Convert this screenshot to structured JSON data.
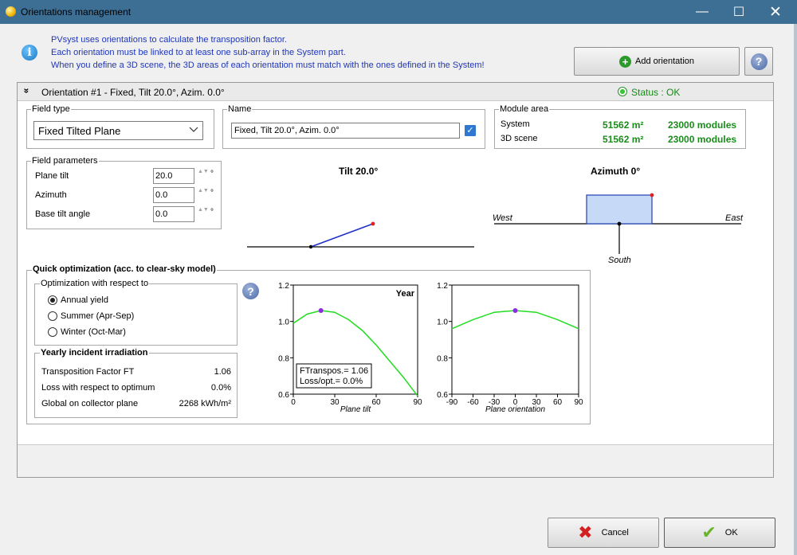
{
  "window": {
    "title": "Orientations management",
    "min_glyph": "—",
    "max_glyph": "☐",
    "close_glyph": "✕"
  },
  "info": {
    "line1": "PVsyst uses orientations to calculate the transposition factor.",
    "line2": "Each orientation must be linked to at least one sub-array in the System part.",
    "line3": "When you define a 3D scene, the 3D areas of each orientation must match with the ones defined in the System!",
    "icon": "info-icon"
  },
  "toolbar": {
    "add_orientation_label": "Add orientation",
    "help_glyph": "?"
  },
  "orientation": {
    "collapse_glyph": "»",
    "title": "Orientation #1 - Fixed, Tilt 20.0°, Azim. 0.0°",
    "status": "Status : OK",
    "status_color": "#168a16"
  },
  "field_type": {
    "label": "Field type",
    "selected": "Fixed Tilted Plane"
  },
  "name": {
    "label": "Name",
    "value": "Fixed, Tilt 20.0°, Azim. 0.0°",
    "checked": true,
    "check_glyph": "✓"
  },
  "module_area": {
    "label": "Module area",
    "rows": [
      {
        "label": "System",
        "area": "51562 m²",
        "modules": "23000 modules"
      },
      {
        "label": "3D scene",
        "area": "51562 m²",
        "modules": "23000 modules"
      }
    ]
  },
  "field_parameters": {
    "label": "Field parameters",
    "unit": "°",
    "spin_glyph": "▲▼",
    "items": [
      {
        "label": "Plane tilt",
        "value": "20.0"
      },
      {
        "label": "Azimuth",
        "value": "0.0"
      },
      {
        "label": "Base tilt angle",
        "value": "0.0"
      }
    ]
  },
  "tilt_diagram": {
    "title": "Tilt 20.0°",
    "tilt_deg": 20
  },
  "azimuth_diagram": {
    "title": "Azimuth 0°",
    "west": "West",
    "east": "East",
    "south": "South",
    "azimuth_deg": 0
  },
  "quick_opt": {
    "label": "Quick optimization (acc. to clear-sky model)",
    "wrt_label": "Optimization with respect to",
    "options": [
      {
        "label": "Annual yield",
        "selected": true
      },
      {
        "label": "Summer (Apr-Sep)",
        "selected": false
      },
      {
        "label": "Winter (Oct-Mar)",
        "selected": false
      }
    ],
    "help_glyph": "?"
  },
  "irradiation": {
    "label": "Yearly incident irradiation",
    "rows": [
      {
        "label": "Transposition Factor FT",
        "value": "1.06"
      },
      {
        "label": "Loss with respect to optimum",
        "value": "0.0%"
      },
      {
        "label": "Global on collector plane",
        "value": "2268 kWh/m²"
      }
    ]
  },
  "chart_data": [
    {
      "type": "line",
      "title": "Year",
      "xlabel": "Plane tilt",
      "ylabel": "",
      "xlim": [
        0,
        90
      ],
      "ylim": [
        0.6,
        1.2
      ],
      "xticks": [
        "0",
        "30",
        "60",
        "90"
      ],
      "yticks": [
        "1.2",
        "1.0",
        "0.8",
        "0.6"
      ],
      "x": [
        0,
        10,
        20,
        30,
        40,
        50,
        60,
        70,
        80,
        90
      ],
      "values": [
        0.99,
        1.04,
        1.06,
        1.05,
        1.01,
        0.95,
        0.87,
        0.78,
        0.69,
        0.59
      ],
      "marker": {
        "x": 20,
        "y": 1.06
      },
      "annotation": [
        "FTranspos.= 1.06",
        "Loss/opt.= 0.0%"
      ],
      "line_color": "#22dd22",
      "marker_color": "#8a2be2"
    },
    {
      "type": "line",
      "title": "",
      "xlabel": "Plane orientation",
      "ylabel": "",
      "xlim": [
        -90,
        90
      ],
      "ylim": [
        0.6,
        1.2
      ],
      "xticks": [
        "-90",
        "-60",
        "-30",
        "0",
        "30",
        "60",
        "90"
      ],
      "yticks": [
        "1.2",
        "1.0",
        "0.8",
        "0.6"
      ],
      "x": [
        -90,
        -60,
        -30,
        0,
        30,
        60,
        90
      ],
      "values": [
        0.96,
        1.01,
        1.05,
        1.06,
        1.05,
        1.01,
        0.96
      ],
      "marker": {
        "x": 0,
        "y": 1.06
      },
      "line_color": "#22dd22",
      "marker_color": "#8a2be2"
    }
  ],
  "dialog_buttons": {
    "cancel": "Cancel",
    "ok": "OK",
    "cancel_glyph": "✖",
    "ok_glyph": "✔"
  }
}
